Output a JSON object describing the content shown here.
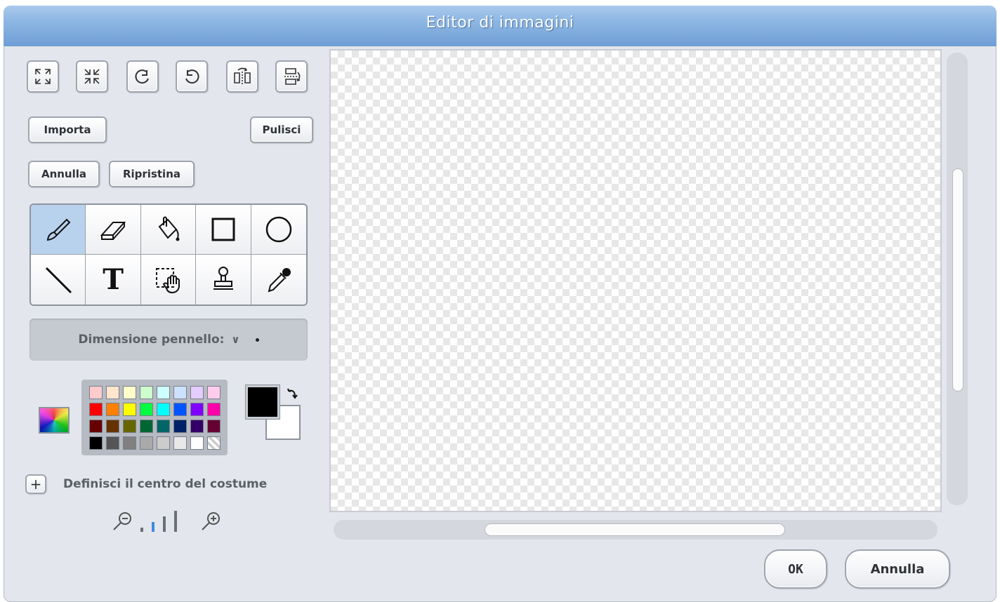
{
  "window": {
    "title": "Editor di immagini"
  },
  "transform_buttons": [
    {
      "name": "grow-icon"
    },
    {
      "name": "shrink-icon"
    },
    {
      "name": "rotate-left-icon"
    },
    {
      "name": "rotate-right-icon"
    },
    {
      "name": "flip-horizontal-icon"
    },
    {
      "name": "flip-vertical-icon"
    }
  ],
  "actions": {
    "import_label": "Importa",
    "clear_label": "Pulisci",
    "undo_label": "Annulla",
    "redo_label": "Ripristina"
  },
  "tools": [
    {
      "name": "paintbrush",
      "selected": true
    },
    {
      "name": "eraser",
      "selected": false
    },
    {
      "name": "fill",
      "selected": false
    },
    {
      "name": "rectangle",
      "selected": false
    },
    {
      "name": "ellipse",
      "selected": false
    },
    {
      "name": "line",
      "selected": false
    },
    {
      "name": "text",
      "selected": false,
      "glyph": "T"
    },
    {
      "name": "select",
      "selected": false
    },
    {
      "name": "stamp",
      "selected": false
    },
    {
      "name": "eyedropper",
      "selected": false
    }
  ],
  "brush": {
    "label": "Dimensione pennello:"
  },
  "palette": {
    "colors": [
      "#ffcccc",
      "#ffe5cc",
      "#ffffcc",
      "#ccffcc",
      "#ccffff",
      "#cce0ff",
      "#e5ccff",
      "#ffccee",
      "#ff0000",
      "#ff8000",
      "#ffff00",
      "#00ff40",
      "#00ffff",
      "#0055ff",
      "#8000ff",
      "#ff00aa",
      "#660000",
      "#663300",
      "#666600",
      "#006633",
      "#006666",
      "#002266",
      "#330066",
      "#660033",
      "#000000",
      "#555555",
      "#808080",
      "#aaaaaa",
      "#cccccc",
      "#e8e8e8",
      "#ffffff",
      "transparent"
    ],
    "foreground": "#000000",
    "background": "#ffffff"
  },
  "center": {
    "label": "Definisci il centro del costume"
  },
  "zoom": {
    "level": 1,
    "levels": 4
  },
  "dialog": {
    "ok_label": "OK",
    "cancel_label": "Annulla"
  }
}
